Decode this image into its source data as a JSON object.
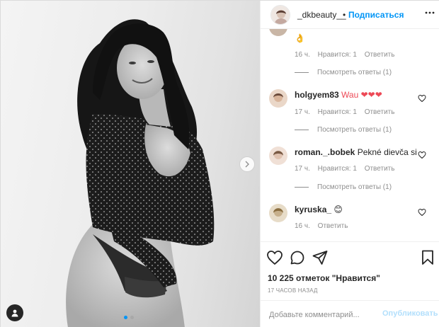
{
  "post": {
    "username": "_dkbeauty__",
    "separator": "•",
    "follow_label": "Подписаться",
    "more_icon": "more-horizontal-icon",
    "media": {
      "slide_count": 2,
      "active_slide": 1
    }
  },
  "comments": [
    {
      "user": "",
      "text": "👌",
      "time": "16 ч.",
      "likes": "Нравится: 1",
      "reply": "Ответить",
      "view_replies": "Посмотреть ответы (1)",
      "avatar_color": "#c9b6a6"
    },
    {
      "user": "holgyem83",
      "text": "Wau ❤❤❤",
      "time": "17 ч.",
      "likes": "Нравится: 1",
      "reply": "Ответить",
      "view_replies": "Посмотреть ответы (1)",
      "avatar_color": "#d8b49a"
    },
    {
      "user": "roman._.bobek",
      "text": "Pekné dievča si",
      "time": "17 ч.",
      "likes": "Нравится: 1",
      "reply": "Ответить",
      "view_replies": "Посмотреть ответы (1)",
      "avatar_color": "#e0c2b0"
    },
    {
      "user": "kyruska_",
      "text": "😊",
      "time": "16 ч.",
      "reply": "Ответить",
      "avatar_color": "#c7b08c"
    }
  ],
  "actions": {
    "likes_text": "10 225 отметок \"Нравится\"",
    "timestamp": "17 ЧАСОВ НАЗАД",
    "comment_placeholder": "Добавьте комментарий...",
    "publish_label": "Опубликовать"
  },
  "colors": {
    "accent": "#0095f6",
    "publish_disabled": "#b2dffc",
    "heart": "#ed4956",
    "meta": "#8e8e8e"
  },
  "icons": [
    "heart-icon",
    "comment-icon",
    "share-icon",
    "bookmark-icon",
    "user-tag-icon",
    "chevron-right-icon"
  ]
}
